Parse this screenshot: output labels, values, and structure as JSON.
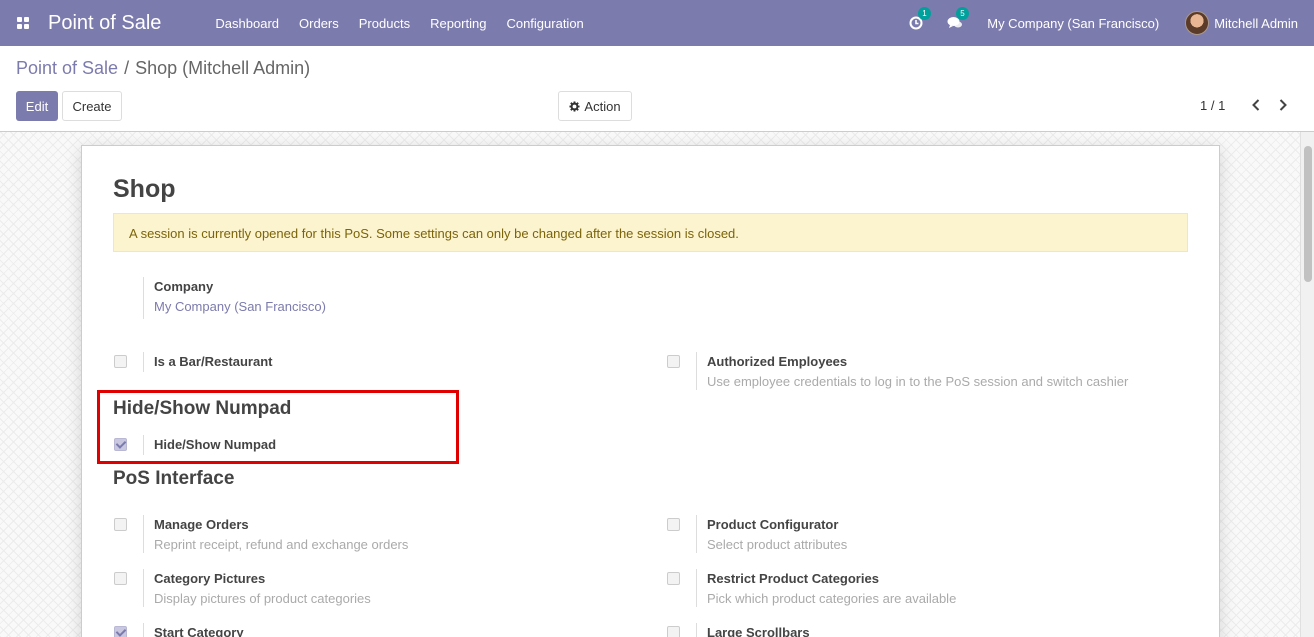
{
  "navbar": {
    "brand": "Point of Sale",
    "menu": [
      "Dashboard",
      "Orders",
      "Products",
      "Reporting",
      "Configuration"
    ],
    "activity_count": "1",
    "message_count": "5",
    "company": "My Company (San Francisco)",
    "user": "Mitchell Admin"
  },
  "breadcrumb": {
    "parent": "Point of Sale",
    "separator": "/",
    "current": "Shop (Mitchell Admin)"
  },
  "buttons": {
    "edit": "Edit",
    "create": "Create",
    "action": "Action"
  },
  "pager": "1 / 1",
  "form": {
    "title": "Shop",
    "alert": "A session is currently opened for this PoS. Some settings can only be changed after the session is closed.",
    "company_label": "Company",
    "company_value": "My Company (San Francisco)",
    "bar_restaurant": {
      "label": "Is a Bar/Restaurant",
      "checked": false
    },
    "authorized_employees": {
      "label": "Authorized Employees",
      "help": "Use employee credentials to log in to the PoS session and switch cashier",
      "checked": false
    },
    "numpad_section": "Hide/Show Numpad",
    "numpad": {
      "label": "Hide/Show Numpad",
      "checked": true
    },
    "interface_section": "PoS Interface",
    "manage_orders": {
      "label": "Manage Orders",
      "help": "Reprint receipt, refund and exchange orders",
      "checked": false
    },
    "product_configurator": {
      "label": "Product Configurator",
      "help": "Select product attributes",
      "checked": false
    },
    "category_pictures": {
      "label": "Category Pictures",
      "help": "Display pictures of product categories",
      "checked": false
    },
    "restrict_categories": {
      "label": "Restrict Product Categories",
      "help": "Pick which product categories are available",
      "checked": false
    },
    "start_category": {
      "label": "Start Category",
      "checked": true
    },
    "large_scrollbars": {
      "label": "Large Scrollbars",
      "checked": false
    }
  },
  "colors": {
    "brand": "#7c7bad",
    "highlight": "#e00000",
    "alert_bg": "#fcf3cf"
  },
  "icons": [
    "apps-icon",
    "activity-icon",
    "messages-icon",
    "gear-icon",
    "chevron-left-icon",
    "chevron-right-icon"
  ]
}
